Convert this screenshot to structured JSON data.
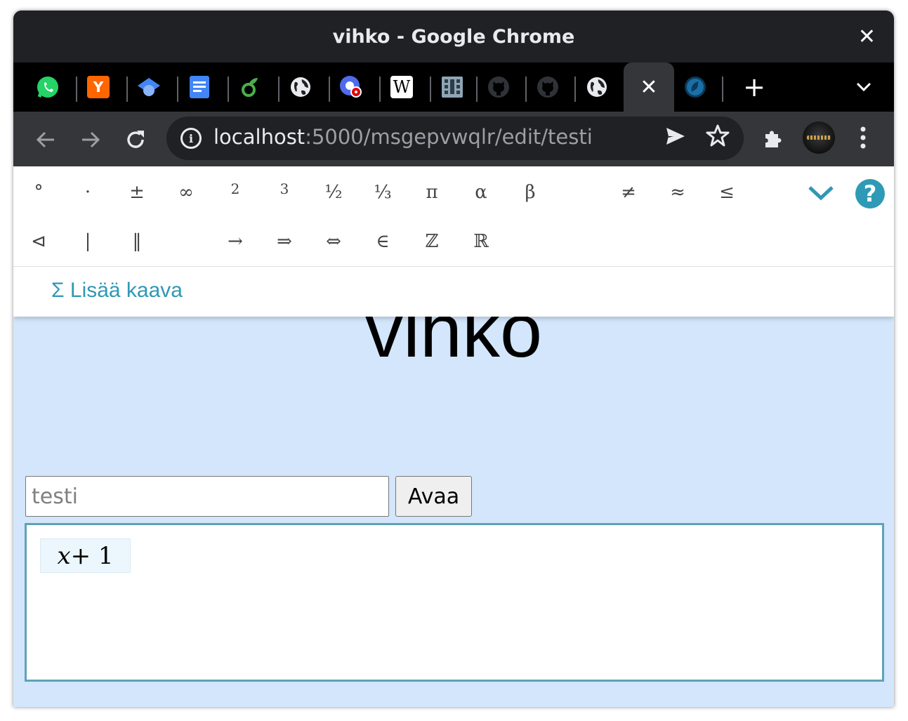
{
  "window": {
    "title": "vihko - Google Chrome",
    "close_label": "✕"
  },
  "tabs": [
    {
      "name": "WhatsApp",
      "icon": "whatsapp-icon",
      "color": "#25d366"
    },
    {
      "name": "Hacker News",
      "icon": "y-combinator-icon",
      "color": "#ff6600",
      "glyph": "Y"
    },
    {
      "name": "Scholar",
      "icon": "graduation-cap-icon",
      "color": "#4285f4"
    },
    {
      "name": "Google Docs",
      "icon": "docs-icon",
      "color": "#4285f4"
    },
    {
      "name": "Overleaf",
      "icon": "overleaf-icon",
      "color": "#4cae4c"
    },
    {
      "name": "Web page",
      "icon": "globe-icon",
      "color": "#e8eaed"
    },
    {
      "name": "Recording app",
      "icon": "record-icon",
      "color": "#4f6bed"
    },
    {
      "name": "Wikipedia",
      "icon": "wikipedia-icon",
      "color": "#ffffff",
      "glyph": "W"
    },
    {
      "name": "Film strip",
      "icon": "film-icon",
      "color": "#8ea6b5"
    },
    {
      "name": "GitHub",
      "icon": "github-icon",
      "color": "#2f3338"
    },
    {
      "name": "GitHub",
      "icon": "github-icon",
      "color": "#2f3338"
    },
    {
      "name": "Web page",
      "icon": "globe-icon",
      "color": "#e8eaed"
    }
  ],
  "active_tab": {
    "close_label": "✕"
  },
  "after_active_tab": {
    "icon": "gnome-web-icon",
    "color": "#1a6fa7"
  },
  "new_tab_label": "+",
  "tab_menu_label": "⌄",
  "toolbar": {
    "url_host": "localhost",
    "url_path": ":5000/msgepvwqlr/edit/testi"
  },
  "symbols": {
    "row1": [
      "°",
      "·",
      "±",
      "∞",
      "2",
      "3",
      "½",
      "⅓",
      "π",
      "α",
      "β",
      "",
      "≠",
      "≈",
      "≤"
    ],
    "row2": [
      "⊲",
      "|",
      "‖",
      "",
      "→",
      "⇒",
      "⇔",
      "∈",
      "ℤ",
      "ℝ"
    ]
  },
  "help_label": "?",
  "add_formula_label": "Σ Lisää kaava",
  "page_title": "vihko",
  "notebook_input": {
    "value": "",
    "placeholder": "testi"
  },
  "open_button_label": "Avaa",
  "formula": {
    "variable": "x",
    "rest": " + 1"
  },
  "colors": {
    "page_background": "#d3e6fb",
    "accent": "#3197b4",
    "editor_border": "#5ea3b6",
    "chrome_dark": "#202124"
  }
}
